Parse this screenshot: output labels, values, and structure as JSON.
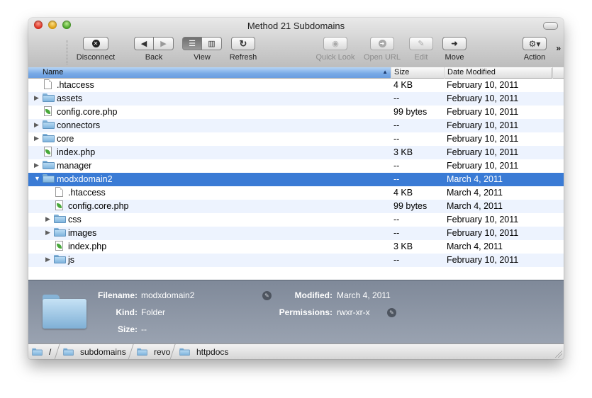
{
  "window": {
    "title": "Method 21 Subdomains"
  },
  "toolbar": {
    "disconnect": "Disconnect",
    "back": "Back",
    "view": "View",
    "refresh": "Refresh",
    "quick_look": "Quick Look",
    "open_url": "Open URL",
    "edit": "Edit",
    "move": "Move",
    "action": "Action",
    "overflow_icon": "chevron-right-double-icon"
  },
  "columns": {
    "name": "Name",
    "size": "Size",
    "date": "Date Modified"
  },
  "files": [
    {
      "name": ".htaccess",
      "size": "4 KB",
      "date": "February 10, 2011",
      "icon": "document-icon",
      "depth": 0,
      "expand": "none"
    },
    {
      "name": "assets",
      "size": "--",
      "date": "February 10, 2011",
      "icon": "folder-icon",
      "depth": 0,
      "expand": "collapsed"
    },
    {
      "name": "config.core.php",
      "size": "99 bytes",
      "date": "February 10, 2011",
      "icon": "php-file-icon",
      "depth": 0,
      "expand": "none"
    },
    {
      "name": "connectors",
      "size": "--",
      "date": "February 10, 2011",
      "icon": "folder-icon",
      "depth": 0,
      "expand": "collapsed"
    },
    {
      "name": "core",
      "size": "--",
      "date": "February 10, 2011",
      "icon": "folder-icon",
      "depth": 0,
      "expand": "collapsed"
    },
    {
      "name": "index.php",
      "size": "3 KB",
      "date": "February 10, 2011",
      "icon": "php-file-icon",
      "depth": 0,
      "expand": "none"
    },
    {
      "name": "manager",
      "size": "--",
      "date": "February 10, 2011",
      "icon": "folder-icon",
      "depth": 0,
      "expand": "collapsed"
    },
    {
      "name": "modxdomain2",
      "size": "--",
      "date": "March 4, 2011",
      "icon": "folder-icon",
      "depth": 0,
      "expand": "expanded",
      "selected": true
    },
    {
      "name": ".htaccess",
      "size": "4 KB",
      "date": "March 4, 2011",
      "icon": "document-icon",
      "depth": 1,
      "expand": "none"
    },
    {
      "name": "config.core.php",
      "size": "99 bytes",
      "date": "March 4, 2011",
      "icon": "php-file-icon",
      "depth": 1,
      "expand": "none"
    },
    {
      "name": "css",
      "size": "--",
      "date": "February 10, 2011",
      "icon": "folder-icon",
      "depth": 1,
      "expand": "collapsed"
    },
    {
      "name": "images",
      "size": "--",
      "date": "February 10, 2011",
      "icon": "folder-icon",
      "depth": 1,
      "expand": "collapsed"
    },
    {
      "name": "index.php",
      "size": "3 KB",
      "date": "March 4, 2011",
      "icon": "php-file-icon",
      "depth": 1,
      "expand": "none"
    },
    {
      "name": "js",
      "size": "--",
      "date": "February 10, 2011",
      "icon": "folder-icon",
      "depth": 1,
      "expand": "collapsed"
    }
  ],
  "info": {
    "filename_label": "Filename:",
    "filename": "modxdomain2",
    "kind_label": "Kind:",
    "kind": "Folder",
    "size_label": "Size:",
    "size": "--",
    "modified_label": "Modified:",
    "modified": "March 4, 2011",
    "permissions_label": "Permissions:",
    "permissions": "rwxr-xr-x"
  },
  "path": [
    "/",
    "subdomains",
    "revo",
    "httpdocs"
  ],
  "colors": {
    "selection": "#3a7bd5",
    "info_panel": "#8a93a2"
  }
}
